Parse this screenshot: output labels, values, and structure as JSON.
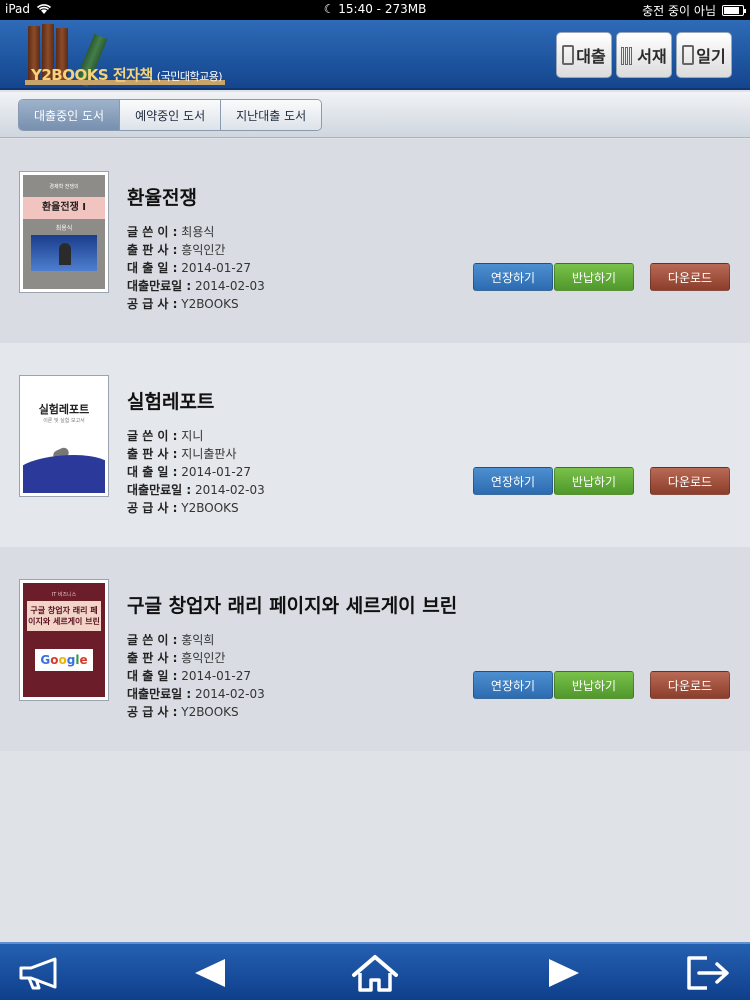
{
  "status": {
    "device": "iPad",
    "time": "15:40 - 273MB",
    "charging": "충전 중이 아님",
    "battery_level": 0.85
  },
  "header": {
    "brand": "Y2BOOKS 전자책",
    "subtitle": "(국민대학교용)",
    "buttons": [
      {
        "label": "대출"
      },
      {
        "label": "서재"
      },
      {
        "label": "일기"
      }
    ]
  },
  "tabs": [
    {
      "label": "대출중인 도서",
      "active": true
    },
    {
      "label": "예약중인 도서",
      "active": false
    },
    {
      "label": "지난대출 도서",
      "active": false
    }
  ],
  "meta_labels": {
    "author": "글 쓴 이 :",
    "publisher": "출 판 사 :",
    "loan_date": "대 출 일 :",
    "due_date": "대출만료일 :",
    "supplier": "공 급 사 :"
  },
  "actions": {
    "extend": "연장하기",
    "return": "반납하기",
    "download": "다운로드"
  },
  "books": [
    {
      "title": "환율전쟁",
      "author": "최용식",
      "publisher": "흥익인간",
      "loan_date": "2014-01-27",
      "due_date": "2014-02-03",
      "supplier": "Y2BOOKS",
      "cover": {
        "top": "경제학 전쟁의",
        "title": "환율전쟁 I",
        "author": "최용식"
      }
    },
    {
      "title": "실험레포트",
      "author": "지니",
      "publisher": "지니출판사",
      "loan_date": "2014-01-27",
      "due_date": "2014-02-03",
      "supplier": "Y2BOOKS",
      "cover": {
        "title": "실험레포트",
        "subtitle": "이론 및 실험 보고서"
      }
    },
    {
      "title": "구글 창업자 래리 페이지와 세르게이 브린",
      "author": "홍익희",
      "publisher": "흥익인간",
      "loan_date": "2014-01-27",
      "due_date": "2014-02-03",
      "supplier": "Y2BOOKS",
      "cover": {
        "top": "IT 비즈니스",
        "title": "구글 창업자 래리 페이지와 세르게이 브린",
        "logo": "Google"
      }
    }
  ]
}
